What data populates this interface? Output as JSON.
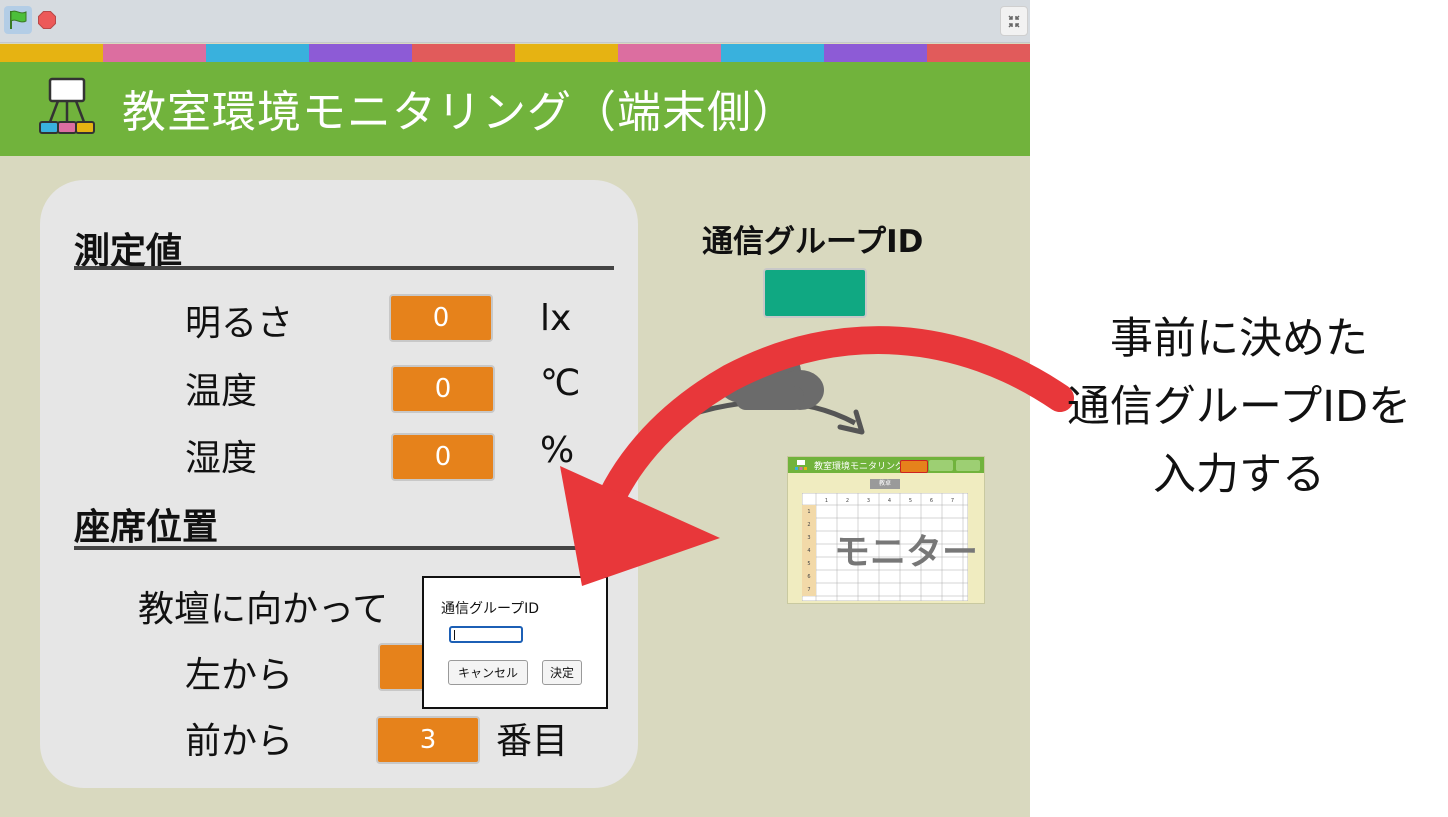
{
  "controls": {
    "green_flag": "green-flag-icon",
    "stop": "stop-sign-icon",
    "fullscreen": "shrink-fullscreen-icon"
  },
  "strip_colors": [
    "#e6b312",
    "#dc6ea0",
    "#39b1dd",
    "#8d5bd6",
    "#e15b5b",
    "#e6b312",
    "#dc6ea0",
    "#39b1dd",
    "#8d5bd6",
    "#e15b5b"
  ],
  "header": {
    "title": "教室環境モニタリング（端末側）",
    "icon": "network-icon"
  },
  "measurements": {
    "title": "測定値",
    "rows": [
      {
        "label": "明るさ",
        "value": "0",
        "unit": "lx"
      },
      {
        "label": "温度",
        "value": "0",
        "unit": "℃"
      },
      {
        "label": "湿度",
        "value": "0",
        "unit": "%"
      }
    ]
  },
  "seat": {
    "title": "座席位置",
    "lead": "教壇に向かって",
    "left_label": "左から",
    "front_label": "前から",
    "front_value": "3",
    "order_suffix": "番目"
  },
  "group": {
    "label": "通信グループID",
    "value": ""
  },
  "monitor_thumb": {
    "app_title": "教室環境モニタリング",
    "button_labels": [
      "",
      "",
      ""
    ],
    "tab": "教卓",
    "col_headers": [
      "1",
      "2",
      "3",
      "4",
      "5",
      "6",
      "7"
    ],
    "row_headers": [
      "1",
      "2",
      "3",
      "4",
      "5",
      "6",
      "7"
    ],
    "overlay_text": "モニター"
  },
  "dialog": {
    "label": "通信グループID",
    "input_value": "",
    "cancel_label": "キャンセル",
    "ok_label": "決定"
  },
  "annotation": {
    "line1": "事前に決めた",
    "line2": "通信グループIDを",
    "line3": "入力する"
  },
  "colors": {
    "header_green": "#71b33c",
    "value_orange": "#e6821b",
    "group_teal": "#10a882",
    "arrow_red": "#e8373a",
    "stage_bg": "#d9d9bf"
  }
}
